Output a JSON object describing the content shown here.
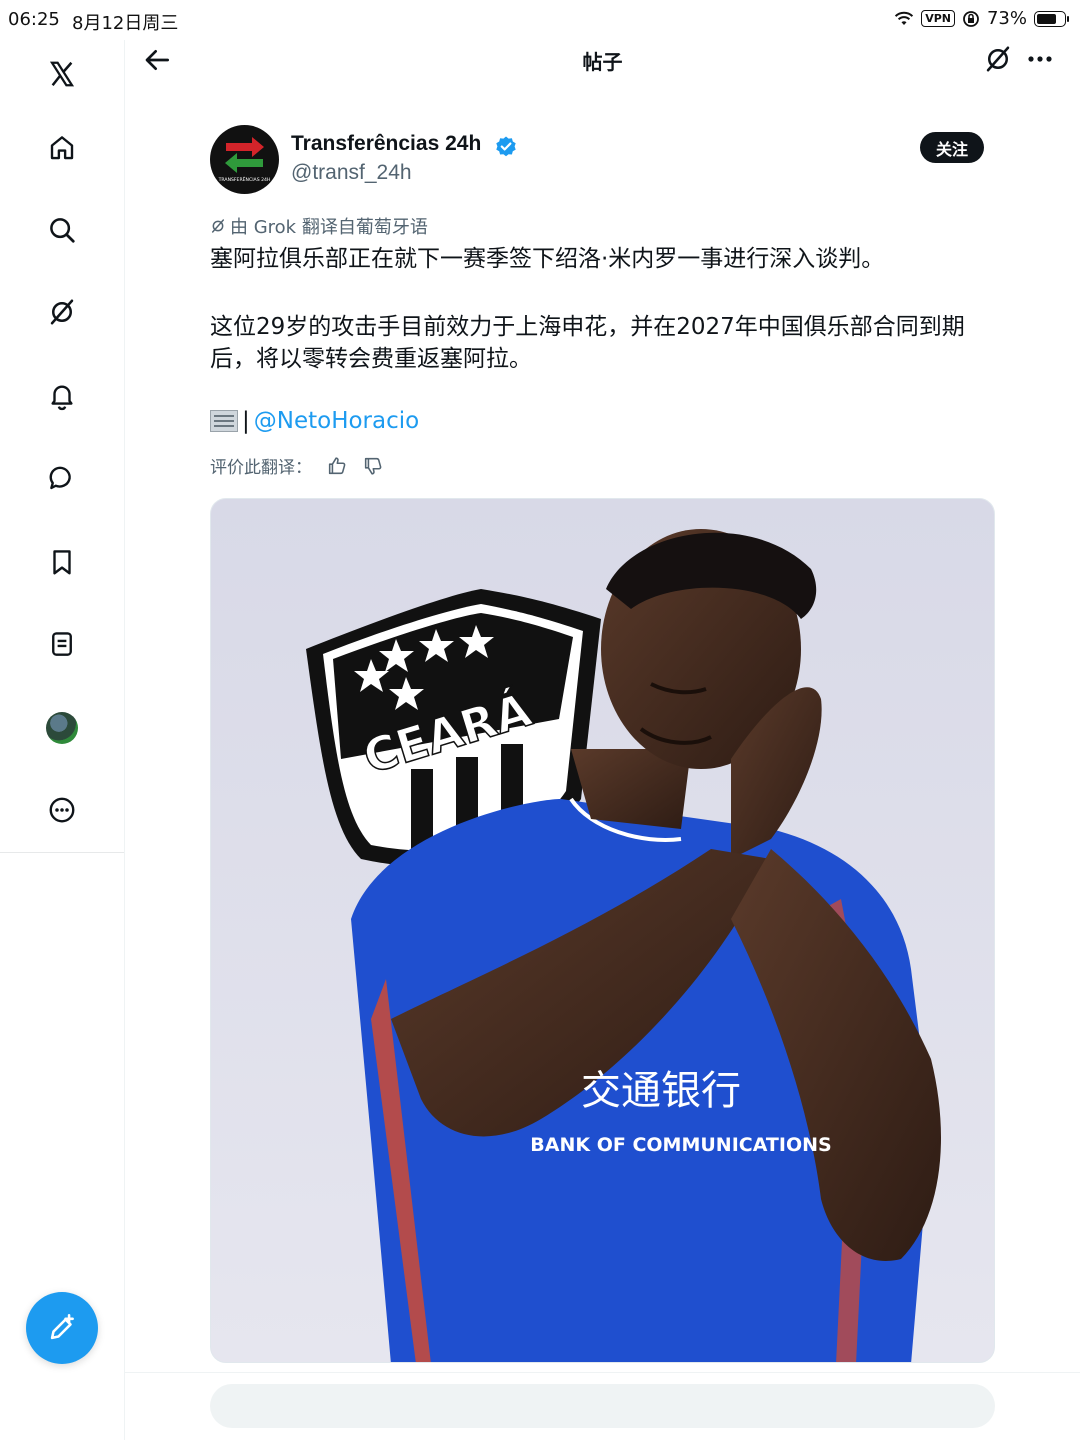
{
  "status_bar": {
    "time": "06:25",
    "date": "8月12日周三",
    "vpn": "VPN",
    "battery": "73%",
    "battery_level": 0.73
  },
  "nav": {
    "title": "帖子"
  },
  "rail": {
    "items": [
      "x-logo",
      "home-icon",
      "search-icon",
      "grok-icon",
      "bell-icon",
      "messages-icon",
      "bookmark-icon",
      "lists-icon",
      "profile-avatar",
      "more-circle-icon"
    ]
  },
  "post": {
    "author_name": "Transferências 24h",
    "author_handle": "@transf_24h",
    "avatar_text": "TRANSFERÊNCIAS 24H",
    "follow_label": "关注",
    "translated_note": "由 Grok 翻译自葡萄牙语",
    "text_line1": "塞阿拉俱乐部正在就下一赛季签下绍洛·米内罗一事进行深入谈判。",
    "text_line2": "这位29岁的攻击手目前效力于上海申花，并在2027年中国俱乐部合同到期后，将以零转会费重返塞阿拉。",
    "source_sep": "|",
    "mention": "@NetoHoracio",
    "rate_label": "评价此翻译："
  },
  "media": {
    "badge_text": "CEARÁ",
    "jersey_chinese": "交通银行",
    "jersey_english": "BANK OF COMMUNICATIONS"
  },
  "colors": {
    "accent": "#1d9bf0",
    "text": "#0f1419",
    "secondary": "#536471",
    "jersey_blue": "#1f4fcf"
  }
}
